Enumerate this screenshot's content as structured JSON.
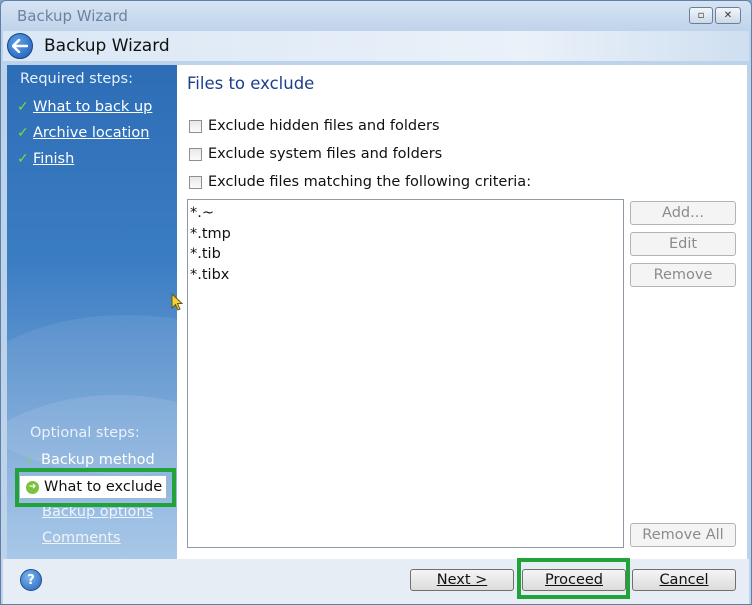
{
  "window": {
    "title": "Backup Wizard"
  },
  "header": {
    "title": "Backup Wizard"
  },
  "sidebar": {
    "required_heading": "Required steps:",
    "required_items": [
      {
        "label": "What to back up"
      },
      {
        "label": "Archive location"
      },
      {
        "label": "Finish"
      }
    ],
    "optional_heading": "Optional steps:",
    "optional_items": [
      {
        "label": "Backup method"
      },
      {
        "label": "What to exclude",
        "current": true
      },
      {
        "label": "Backup options"
      },
      {
        "label": "Comments"
      }
    ]
  },
  "main": {
    "title": "Files to exclude",
    "checkboxes": [
      {
        "label": "Exclude hidden files and folders",
        "checked": false
      },
      {
        "label": "Exclude system files and folders",
        "checked": false
      },
      {
        "label": "Exclude files matching the following criteria:",
        "checked": false
      }
    ],
    "criteria": [
      "*.~",
      "*.tmp",
      "*.tib",
      "*.tibx"
    ],
    "buttons": {
      "add": "Add...",
      "edit": "Edit",
      "remove": "Remove",
      "remove_all": "Remove All"
    }
  },
  "footer": {
    "next": "Next >",
    "proceed": "Proceed",
    "cancel": "Cancel"
  },
  "colors": {
    "highlight": "#21a33a",
    "accent": "#1c3f8a"
  }
}
